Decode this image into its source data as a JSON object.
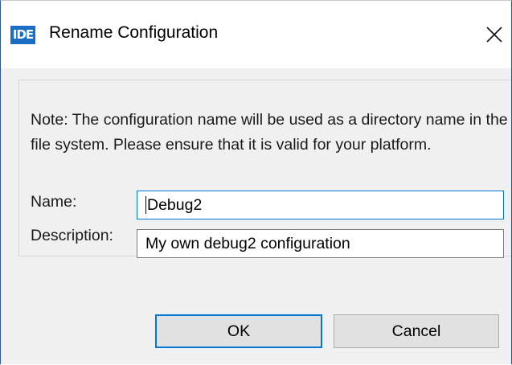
{
  "window": {
    "icon_text": "IDE",
    "title": "Rename Configuration",
    "close_glyph": "×"
  },
  "form": {
    "note": "Note: The configuration name will be used as a directory name in the file system.  Please ensure that it is valid for your platform.",
    "name_label": "Name:",
    "name_value": "Debug2",
    "description_label": "Description:",
    "description_value": "My own debug2 configuration"
  },
  "buttons": {
    "ok": "OK",
    "cancel": "Cancel"
  },
  "colors": {
    "accent": "#0078d7",
    "icon_bg": "#1a6fc4",
    "body_bg": "#f0f0f0"
  },
  "state": {
    "focused_field": "name",
    "default_button": "ok"
  }
}
